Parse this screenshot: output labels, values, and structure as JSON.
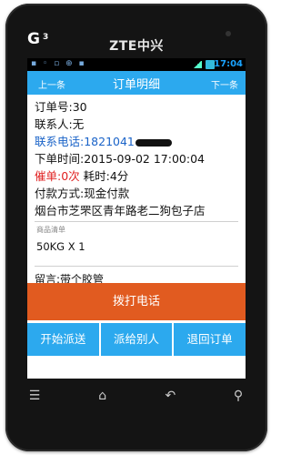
{
  "device": {
    "brand": "ZTE中兴",
    "logo": "G",
    "logo_sup": "3"
  },
  "statusbar": {
    "time": "17:04"
  },
  "titlebar": {
    "prev_label": "上一条",
    "title": "订单明细",
    "next_label": "下一条"
  },
  "order": {
    "order_no": "订单号:30",
    "contact": "联系人:无",
    "phone_label": "联系电话:",
    "phone_value": "1821041",
    "order_time": "下单时间:2015-09-02 17:00:04",
    "reminder_label": "催单:",
    "reminder_count": "0次",
    "elapsed": " 耗时:4分",
    "payment": "付款方式:现金付款",
    "address": "烟台市芝罘区青年路老二狗包子店",
    "goods_header": "商品清单",
    "goods_item": "50KG X 1",
    "remark": "留言:带个胶管"
  },
  "actions": {
    "call_label": "拨打电话",
    "start_delivery_label": "开始派送",
    "reassign_label": "派给别人",
    "return_label": "退回订单"
  },
  "colors": {
    "accent": "#2ca9ee",
    "call": "#e15b20",
    "phone_text": "#1a63c8",
    "warn": "#e02020"
  },
  "nav_icons": [
    "menu-icon",
    "home-icon",
    "back-icon",
    "search-icon"
  ]
}
